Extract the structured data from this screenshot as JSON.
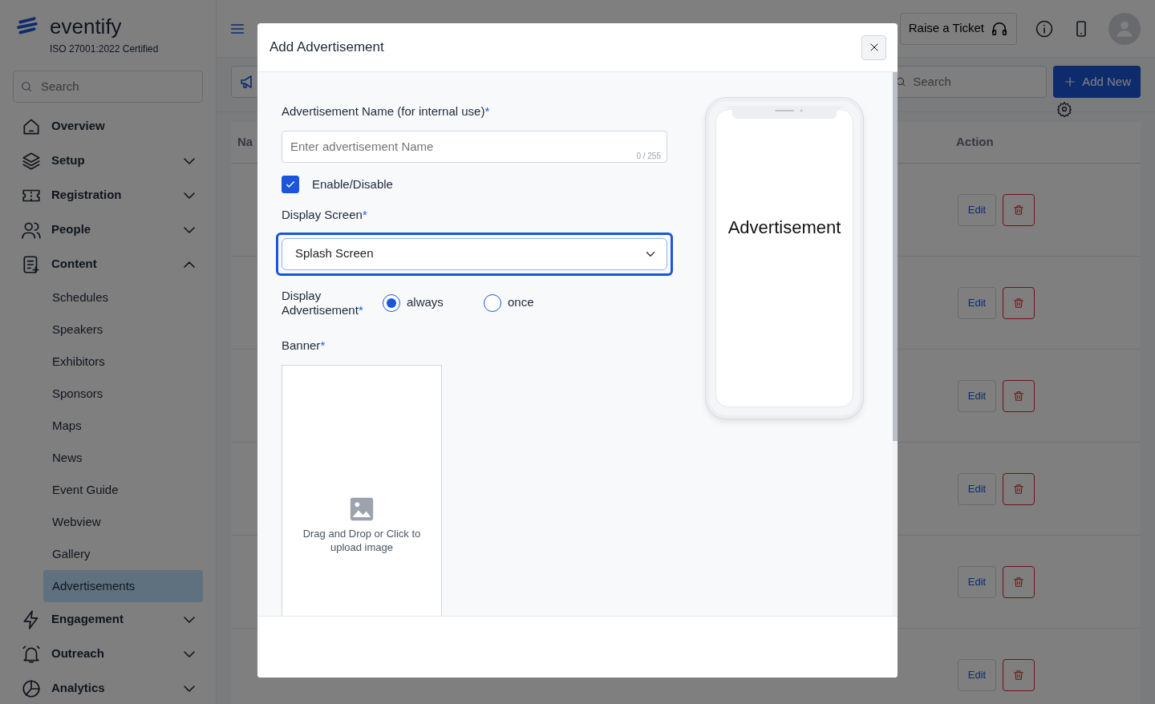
{
  "sidebar": {
    "brand": "eventify",
    "certification": "ISO 27001:2022 Certified",
    "search": {
      "placeholder": "Search"
    },
    "items": [
      {
        "label": "Overview",
        "kind": "link"
      },
      {
        "label": "Setup",
        "kind": "group",
        "expanded": false
      },
      {
        "label": "Registration",
        "kind": "group",
        "expanded": false
      },
      {
        "label": "People",
        "kind": "group",
        "expanded": false
      },
      {
        "label": "Content",
        "kind": "group",
        "expanded": true,
        "children": [
          {
            "label": "Schedules",
            "selected": false
          },
          {
            "label": "Speakers",
            "selected": false
          },
          {
            "label": "Exhibitors",
            "selected": false
          },
          {
            "label": "Sponsors",
            "selected": false
          },
          {
            "label": "Maps",
            "selected": false
          },
          {
            "label": "News",
            "selected": false
          },
          {
            "label": "Event Guide",
            "selected": false
          },
          {
            "label": "Webview",
            "selected": false
          },
          {
            "label": "Gallery",
            "selected": false
          },
          {
            "label": "Advertisements",
            "selected": true
          }
        ]
      },
      {
        "label": "Engagement",
        "kind": "group",
        "expanded": false
      },
      {
        "label": "Outreach",
        "kind": "group",
        "expanded": false
      },
      {
        "label": "Analytics",
        "kind": "group",
        "expanded": false
      }
    ]
  },
  "topbar": {
    "ticket_button": "Raise a Ticket"
  },
  "toolbar": {
    "search": {
      "placeholder": "Search"
    },
    "add_button": "Add New"
  },
  "table": {
    "columns": [
      "Na",
      "Action"
    ],
    "rows": [
      {
        "edit": "Edit"
      },
      {
        "edit": "Edit"
      },
      {
        "edit": "Edit"
      },
      {
        "edit": "Edit"
      },
      {
        "edit": "Edit"
      },
      {
        "edit": "Edit"
      }
    ]
  },
  "modal": {
    "title": "Add Advertisement",
    "name_field": {
      "label": "Advertisement Name (for internal use)",
      "mark": "*",
      "placeholder": "Enter advertisement Name",
      "counter": "0 / 255"
    },
    "enable": {
      "label": "Enable/Disable",
      "checked": true
    },
    "display_screen": {
      "label": "Display Screen",
      "mark": "*",
      "value": "Splash Screen",
      "focused": true
    },
    "display_mode": {
      "label": "Display Advertisement",
      "mark": "*",
      "options": [
        {
          "label": "always",
          "selected": true
        },
        {
          "label": "once",
          "selected": false
        }
      ]
    },
    "banner": {
      "label": "Banner",
      "mark": "*",
      "hint": "Drag and Drop or Click to upload image"
    },
    "preview": {
      "text": "Advertisement"
    }
  }
}
